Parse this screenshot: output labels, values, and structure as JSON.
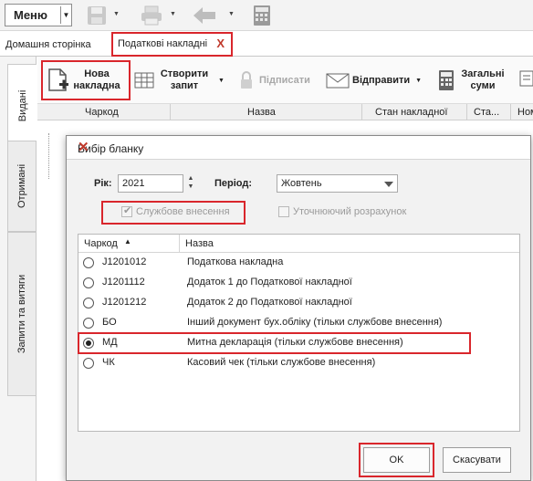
{
  "toolbar": {
    "menu_label": "Меню"
  },
  "tabs": {
    "home": "Домашня сторінка",
    "active": "Податкові накладні",
    "close_glyph": "X"
  },
  "side_tabs": [
    "Видані",
    "Отримані",
    "Запити та витяги"
  ],
  "actions": {
    "new_doc": "Нова накладна",
    "create_request": "Створити запит",
    "sign": "Підписати",
    "send": "Відправити",
    "totals": "Загальні суми"
  },
  "grid": {
    "columns": [
      "Чаркод",
      "Назва",
      "Стан накладної",
      "Ста...",
      "Ном"
    ]
  },
  "dialog": {
    "title": "Вибір бланку",
    "close_glyph": "✕",
    "year_label": "Рік:",
    "year_value": "2021",
    "period_label": "Період:",
    "period_value": "Жовтень",
    "service_entry": "Службове внесення",
    "service_entry_checked": true,
    "clarifying_calc": "Уточнюючий розрахунок",
    "clarifying_calc_checked": false,
    "list_headers": {
      "code": "Чаркод",
      "name": "Назва"
    },
    "rows": [
      {
        "code": "J1201012",
        "name": "Податкова накладна",
        "selected": false
      },
      {
        "code": "J1201112",
        "name": "Додаток 1 до Податкової накладної",
        "selected": false
      },
      {
        "code": "J1201212",
        "name": "Додаток 2 до Податкової накладної",
        "selected": false
      },
      {
        "code": "БО",
        "name": "Інший документ бух.обліку (тільки службове внесення)",
        "selected": false
      },
      {
        "code": "МД",
        "name": "Митна декларація (тільки службове внесення)",
        "selected": true
      },
      {
        "code": "ЧК",
        "name": "Касовий чек (тільки службове внесення)",
        "selected": false
      }
    ],
    "ok": "OK",
    "cancel": "Скасувати"
  },
  "colors": {
    "highlight": "#d9262c"
  }
}
